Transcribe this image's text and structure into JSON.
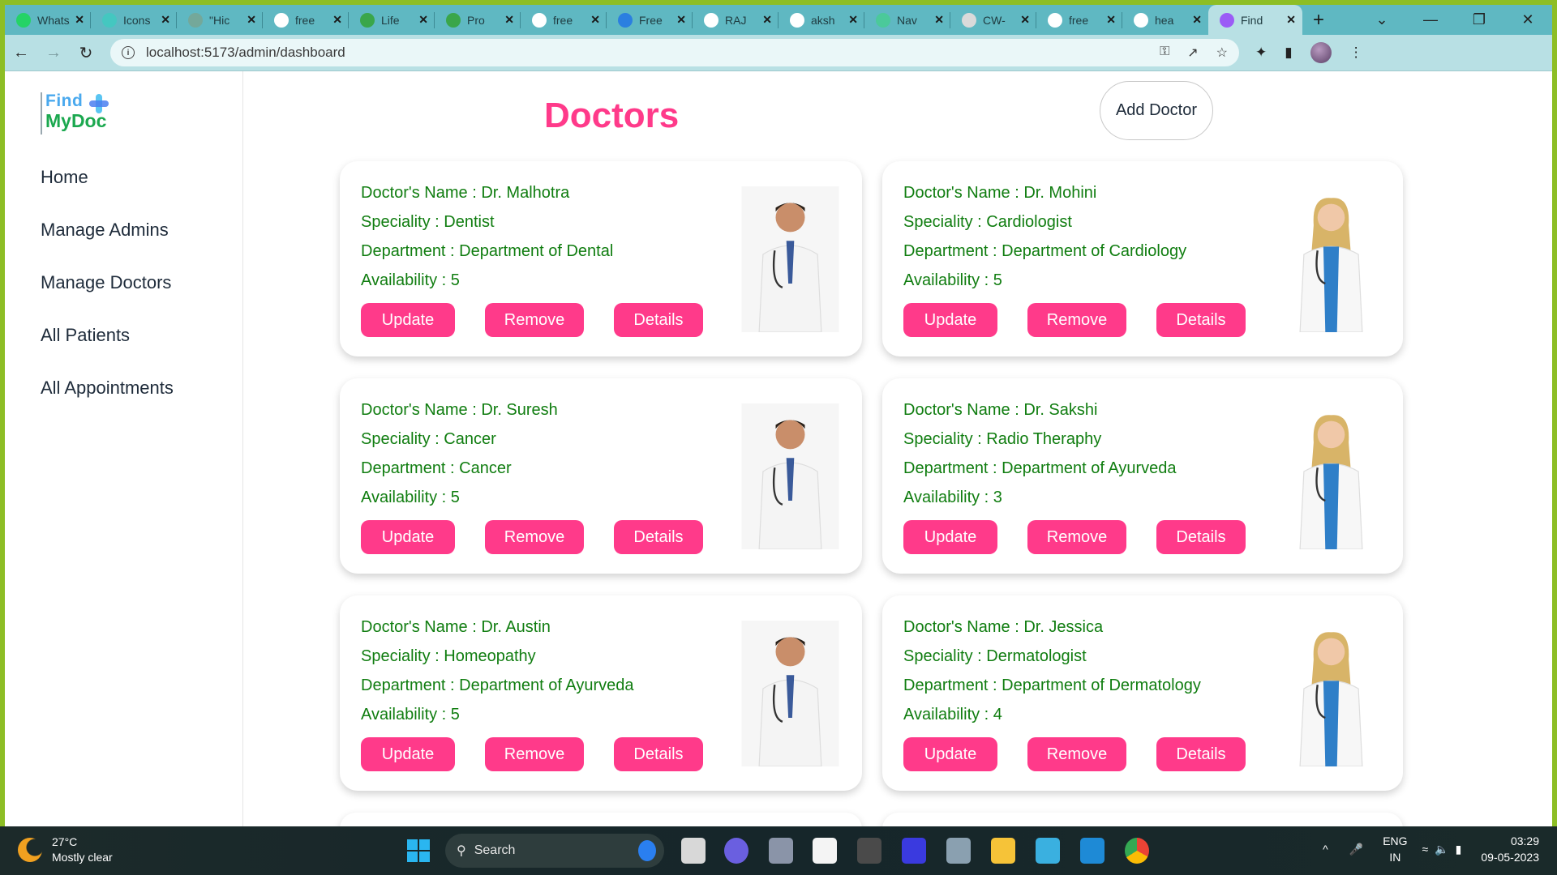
{
  "browser": {
    "tabs": [
      {
        "title": "WhatsApp",
        "icon": "whatsapp-icon",
        "color": "#25d366"
      },
      {
        "title": "Icons",
        "icon": "bolt-icon",
        "color": "#44c7c0"
      },
      {
        "title": "\"Hic",
        "icon": "chatgpt-icon",
        "color": "#74a89a"
      },
      {
        "title": "free",
        "icon": "google-icon",
        "color": "#ffffff"
      },
      {
        "title": "Life",
        "icon": "lifecare-icon",
        "color": "#3aa64a"
      },
      {
        "title": "Pro",
        "icon": "px-icon",
        "color": "#3aa64a"
      },
      {
        "title": "free",
        "icon": "google-icon",
        "color": "#ffffff"
      },
      {
        "title": "Free",
        "icon": "robot-icon",
        "color": "#2b7fe0"
      },
      {
        "title": "RAJ",
        "icon": "github-icon",
        "color": "#ffffff"
      },
      {
        "title": "aksh",
        "icon": "github-icon",
        "color": "#ffffff"
      },
      {
        "title": "Nav",
        "icon": "bolt-icon",
        "color": "#4bc99a"
      },
      {
        "title": "CW-",
        "icon": "document-icon",
        "color": "#dadada"
      },
      {
        "title": "free",
        "icon": "google-icon",
        "color": "#ffffff"
      },
      {
        "title": "hea",
        "icon": "google-icon",
        "color": "#ffffff"
      },
      {
        "title": "Find",
        "icon": "vite-icon",
        "color": "#9b5cf6",
        "active": true
      }
    ],
    "new_tab_label": "+",
    "url": "localhost:5173/admin/dashboard"
  },
  "app": {
    "logo": {
      "line1": "Find",
      "line2": "MyDoc"
    },
    "nav": [
      "Home",
      "Manage Admins",
      "Manage Doctors",
      "All Patients",
      "All Appointments"
    ],
    "page_title": "Doctors",
    "add_button": "Add Doctor",
    "labels": {
      "name": "Doctor's Name : ",
      "speciality": "Speciality : ",
      "department": "Department : ",
      "availability": "Availability : "
    },
    "buttons": {
      "update": "Update",
      "remove": "Remove",
      "details": "Details"
    },
    "colors": {
      "accent": "#ff3a8a",
      "field_text": "#107d10"
    },
    "doctors": [
      {
        "name": "Dr. Malhotra",
        "speciality": "Dentist",
        "department": "Department of Dental",
        "availability": "5",
        "photo": "male-doctor-photo"
      },
      {
        "name": "Dr. Mohini",
        "speciality": "Cardiologist",
        "department": "Department of Cardiology",
        "availability": "5",
        "photo": "female-doctor-photo"
      },
      {
        "name": "Dr. Suresh",
        "speciality": "Cancer",
        "department": "Cancer",
        "availability": "5",
        "photo": "male-doctor-photo"
      },
      {
        "name": "Dr. Sakshi",
        "speciality": "Radio Theraphy",
        "department": "Department of Ayurveda",
        "availability": "3",
        "photo": "female-doctor-photo"
      },
      {
        "name": "Dr. Austin",
        "speciality": "Homeopathy",
        "department": "Department of Ayurveda",
        "availability": "5",
        "photo": "male-doctor-photo"
      },
      {
        "name": "Dr. Jessica",
        "speciality": "Dermatologist",
        "department": "Department of Dermatology",
        "availability": "4",
        "photo": "female-doctor-photo"
      }
    ]
  },
  "taskbar": {
    "weather_temp": "27°C",
    "weather_desc": "Mostly clear",
    "search_placeholder": "Search",
    "lang_line1": "ENG",
    "lang_line2": "IN",
    "time": "03:29",
    "date": "09-05-2023"
  }
}
